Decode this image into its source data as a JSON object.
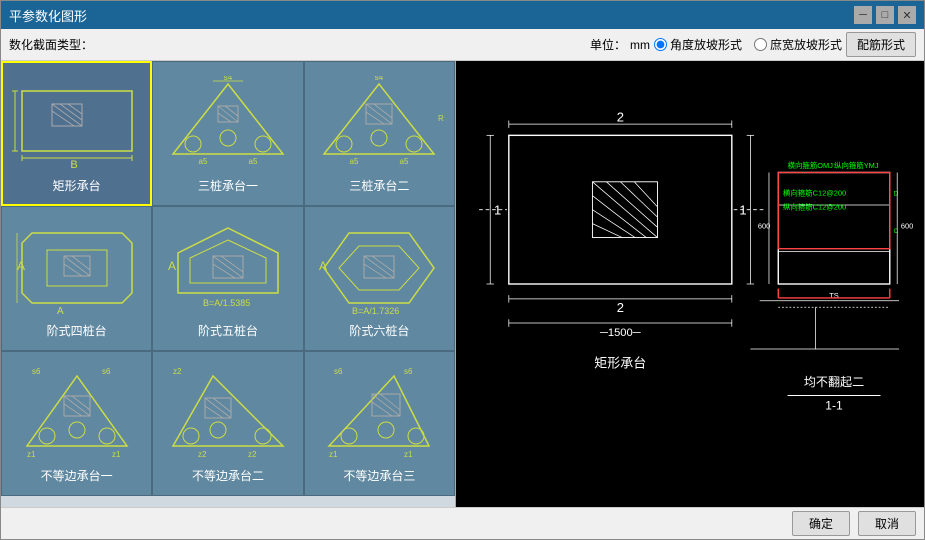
{
  "window": {
    "title": "平参数化图形",
    "controls": [
      "minimize",
      "maximize",
      "close"
    ]
  },
  "toolbar": {
    "section_type_label": "数化截面类型：",
    "unit_label": "单位：",
    "unit_value": "mm",
    "radio_options": [
      {
        "label": "角度放坡形式",
        "value": "angle",
        "checked": true
      },
      {
        "label": "庶宽放坡形式",
        "value": "width",
        "checked": false
      }
    ],
    "peijin_button_label": "配筋形式"
  },
  "shapes": [
    {
      "id": 0,
      "label": "矩形承台",
      "selected": true
    },
    {
      "id": 1,
      "label": "三桩承台一",
      "selected": false
    },
    {
      "id": 2,
      "label": "三桩承台二",
      "selected": false
    },
    {
      "id": 3,
      "label": "阶式四桩台",
      "selected": false
    },
    {
      "id": 4,
      "label": "阶式五桩台",
      "selected": false
    },
    {
      "id": 5,
      "label": "阶式六桩台",
      "selected": false
    },
    {
      "id": 6,
      "label": "不等边承台一",
      "selected": false
    },
    {
      "id": 7,
      "label": "不等边承台二",
      "selected": false
    },
    {
      "id": 8,
      "label": "不等边承台三",
      "selected": false
    }
  ],
  "bottom_bar": {
    "ok_label": "确定",
    "cancel_label": "取消"
  },
  "cad": {
    "shape_label": "矩形承台",
    "section_label": "1-1",
    "subtitle": "均不翻起二",
    "dim_bottom": "1500",
    "dim_left": "1",
    "dim_right": "1",
    "dim_top": "2",
    "dim_2": "2",
    "annotations": {
      "heng_top": "横向箍筋OMJ",
      "zong_top": "纵向箍筋YMJ",
      "heng_inner": "横向箍筋C12@200",
      "zong_inner": "纵向箍筋C12@200"
    }
  }
}
